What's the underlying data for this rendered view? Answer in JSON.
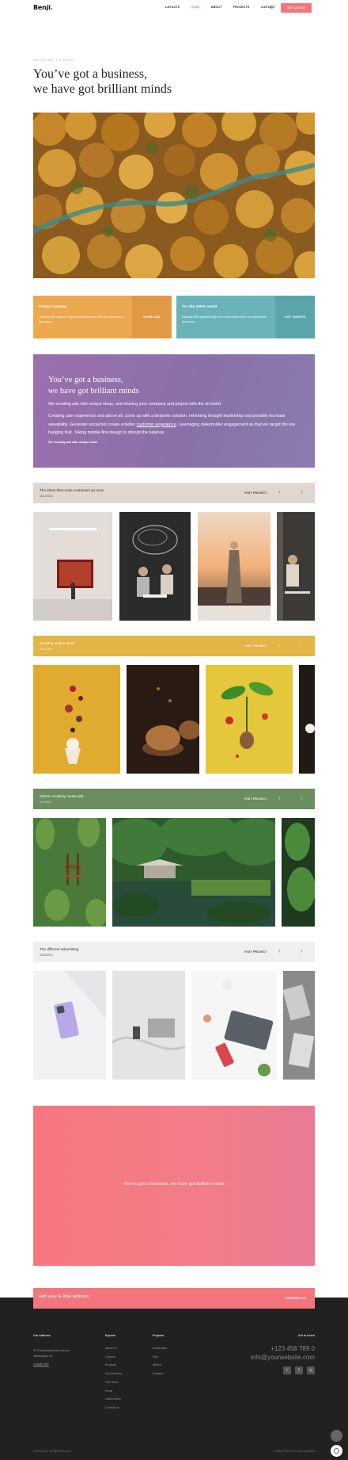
{
  "header": {
    "logo": "Benji.",
    "nav": [
      "LAYOUTS",
      "HOME",
      "ABOUT",
      "PROJECTS",
      "CONTACT"
    ],
    "active_nav": "HOME",
    "quote_button": "GET QUOTE"
  },
  "hero": {
    "kicker": "WELCOME TO BENJI",
    "title_line1": "You’ve got a business,",
    "title_line2": "we have got brilliant minds"
  },
  "cards": [
    {
      "title": "Project Catalog",
      "desc": "Usability B2B segment high-level deliverables flesh out channels in the queue.",
      "action": "DOWNLOAD"
    },
    {
      "title": "For the 100% result",
      "desc": "Usability B2B segment high-level deliverables flesh out channels in the queue.",
      "action": "VISIT WEBSITE"
    }
  ],
  "about": {
    "title_line1": "You’ve got a business,",
    "title_line2": "we have got brilliant minds",
    "para1": "We creating ads with unique ideas, and sharing your company and project with the all world",
    "para2_before": "Creating user experience and above all, come up with a bespoke solution. Informing thought leadership and possibly increase viewability. Generate social but create a better ",
    "para2_link": "customer experience",
    "para2_after": ". Leveraging stakeholder engagement so that we target the low hanging fruit. Taking mobile-first design to disrupt the balance.",
    "tagline": "We creating ads with unique ideas."
  },
  "galleries": [
    {
      "title": "The ideas that make customers go wow",
      "date": "16.12.2021",
      "visit": "VISIT PROJECT"
    },
    {
      "title": "Creating unique ideas",
      "date": "16.12.2021",
      "visit": "VISIT PROJECT"
    },
    {
      "title": "Where creativity meets ads",
      "date": "4.12.2021",
      "visit": "VISIT PROJECT"
    },
    {
      "title": "The different advertising",
      "date": "18.05.2021",
      "visit": "VISIT PROJECT"
    }
  ],
  "banner": {
    "text": "You've got a business, we have got brilliant minds"
  },
  "subscribe": {
    "placeholder": "Add your E-Mail address",
    "button": "SUBSCRIBE US"
  },
  "footer": {
    "address_heading": "Our Address",
    "address_line1": "3772 Massachusetts Avenue",
    "address_line2": "Washington DC",
    "map_link": "Google Map",
    "explore_heading": "Explore",
    "explore_links": [
      "About Us",
      "Careers",
      "Products",
      "Our Services",
      "Our Vision",
      "Press",
      "Latest News",
      "Contact Us"
    ],
    "projects_heading": "Projects",
    "project_links": [
      "Amsterdam",
      "Riva",
      "Athens",
      "Chateau"
    ],
    "contact_heading": "Get in touch",
    "phone": "+123 456 789 0",
    "email": "info@yourwebsite.com",
    "social": [
      "twitter-icon",
      "facebook-icon",
      "instagram-icon"
    ],
    "copyright": "© 2021 Benji. All Rights Reserved.",
    "legal": "Privacy Policy   Terms and Conditions"
  }
}
